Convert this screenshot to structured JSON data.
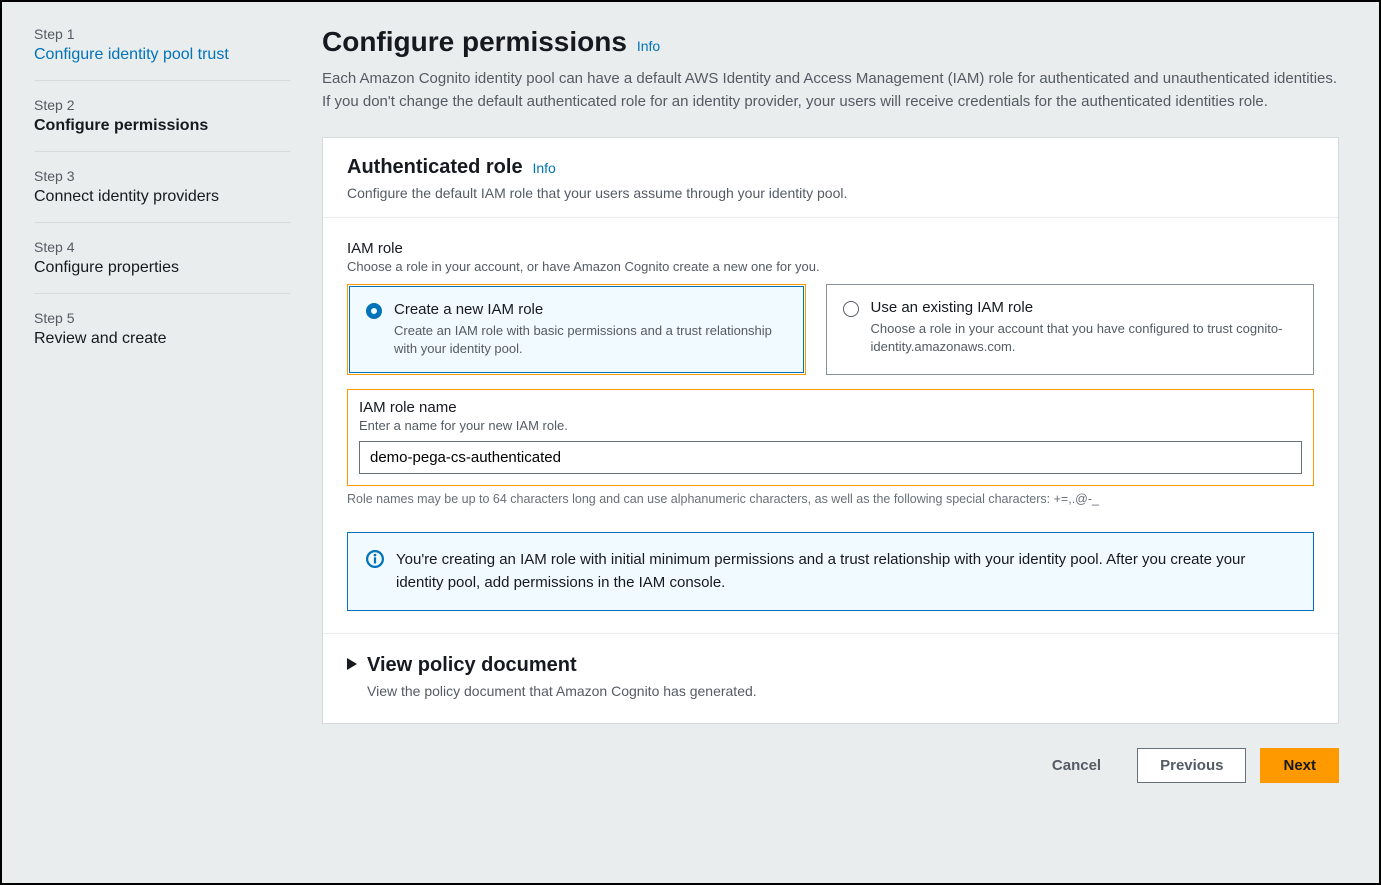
{
  "sidebar": {
    "steps": [
      {
        "number": "Step 1",
        "title": "Configure identity pool trust",
        "state": "active"
      },
      {
        "number": "Step 2",
        "title": "Configure permissions",
        "state": "current"
      },
      {
        "number": "Step 3",
        "title": "Connect identity providers",
        "state": ""
      },
      {
        "number": "Step 4",
        "title": "Configure properties",
        "state": ""
      },
      {
        "number": "Step 5",
        "title": "Review and create",
        "state": ""
      }
    ]
  },
  "header": {
    "title": "Configure permissions",
    "info": "Info",
    "description": "Each Amazon Cognito identity pool can have a default AWS Identity and Access Management (IAM) role for authenticated and unauthenticated identities. If you don't change the default authenticated role for an identity provider, your users will receive credentials for the authenticated identities role."
  },
  "card": {
    "title": "Authenticated role",
    "info": "Info",
    "description": "Configure the default IAM role that your users assume through your identity pool.",
    "iamRole": {
      "label": "IAM role",
      "desc": "Choose a role in your account, or have Amazon Cognito create a new one for you.",
      "options": [
        {
          "title": "Create a new IAM role",
          "desc": "Create an IAM role with basic permissions and a trust relationship with your identity pool.",
          "selected": true
        },
        {
          "title": "Use an existing IAM role",
          "desc": "Choose a role in your account that you have configured to trust cognito-identity.amazonaws.com.",
          "selected": false
        }
      ]
    },
    "roleName": {
      "label": "IAM role name",
      "desc": "Enter a name for your new IAM role.",
      "value": "demo-pega-cs-authenticated",
      "constraint": "Role names may be up to 64 characters long and can use alphanumeric characters, as well as the following special characters: +=,.@-_"
    },
    "alert": "You're creating an IAM role with initial minimum permissions and a trust relationship with your identity pool. After you create your identity pool, add permissions in the IAM console.",
    "policy": {
      "title": "View policy document",
      "desc": "View the policy document that Amazon Cognito has generated."
    }
  },
  "footer": {
    "cancel": "Cancel",
    "previous": "Previous",
    "next": "Next"
  }
}
